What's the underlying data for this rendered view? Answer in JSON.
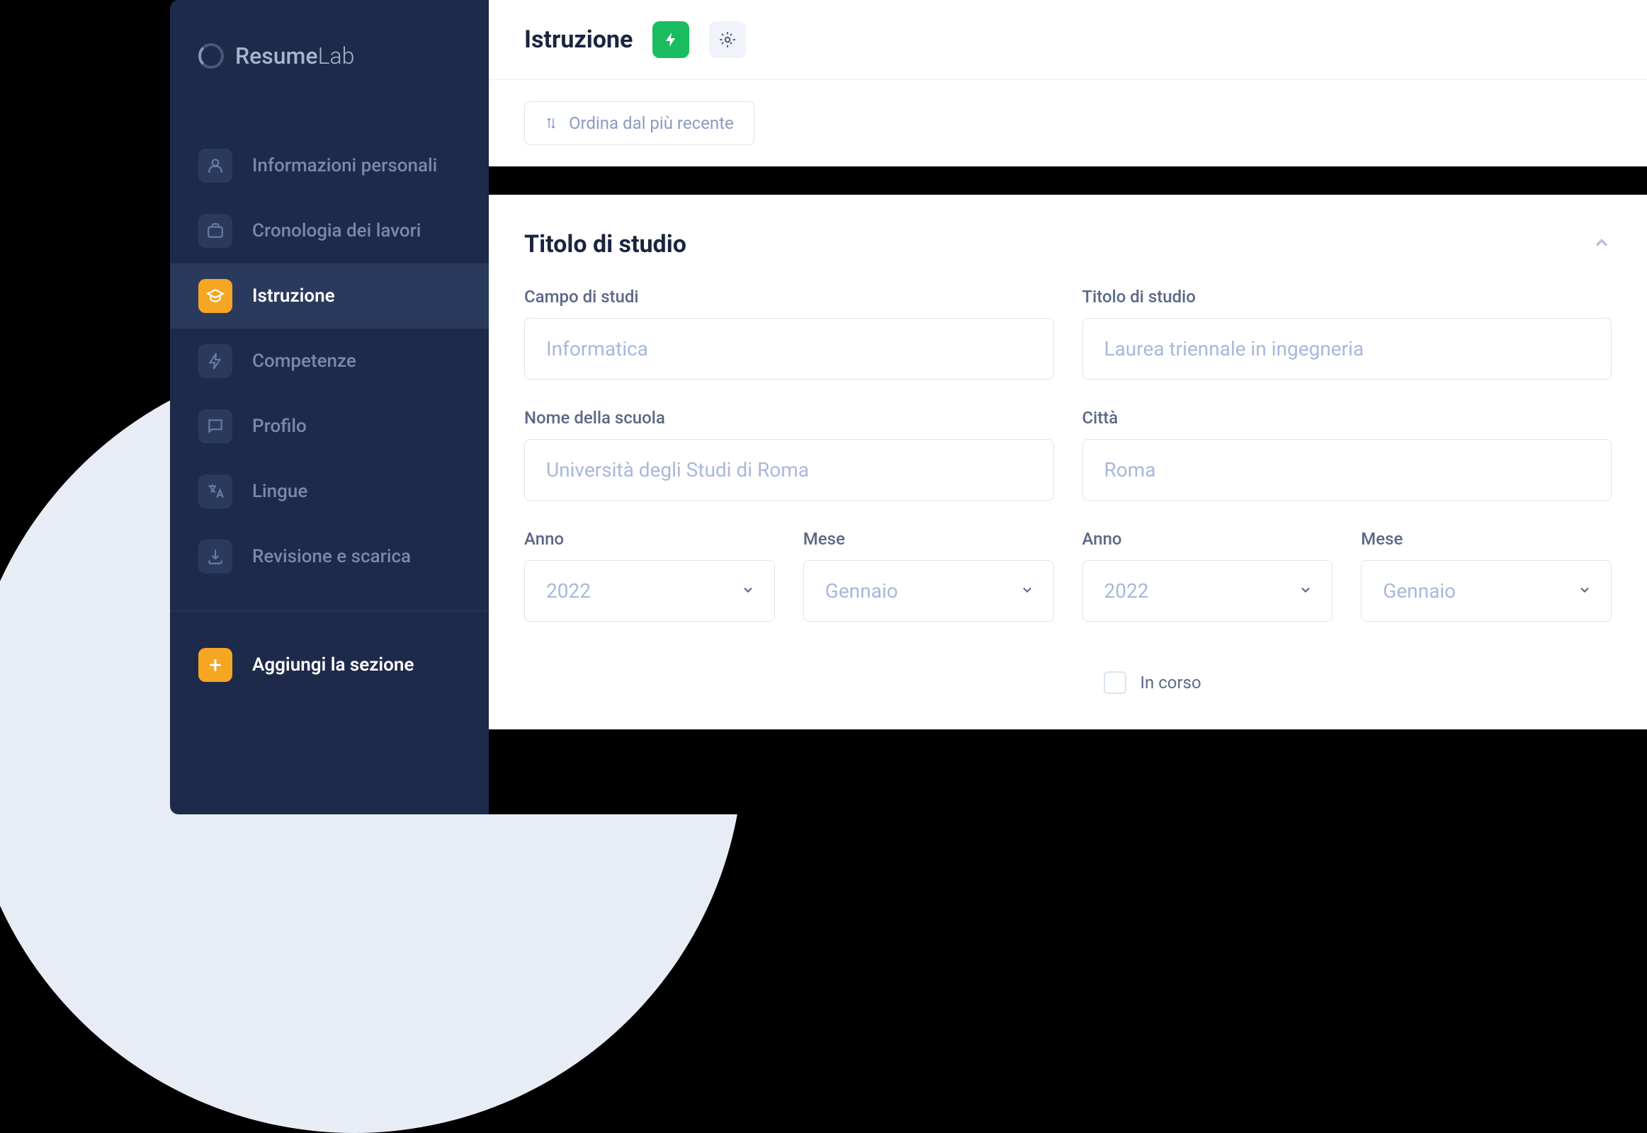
{
  "brand": {
    "name_first": "Resume",
    "name_second": "Lab"
  },
  "sidebar": {
    "items": [
      {
        "label": "Informazioni personali"
      },
      {
        "label": "Cronologia dei lavori"
      },
      {
        "label": "Istruzione"
      },
      {
        "label": "Competenze"
      },
      {
        "label": "Profilo"
      },
      {
        "label": "Lingue"
      },
      {
        "label": "Revisione e scarica"
      }
    ],
    "add_section": "Aggiungi la sezione"
  },
  "header": {
    "title": "Istruzione"
  },
  "sort": {
    "label": "Ordina dal più recente"
  },
  "card": {
    "title": "Titolo di studio",
    "fields": {
      "field_of_study": {
        "label": "Campo di studi",
        "placeholder": "Informatica"
      },
      "degree": {
        "label": "Titolo di studio",
        "placeholder": "Laurea triennale in ingegneria"
      },
      "school": {
        "label": "Nome della scuola",
        "placeholder": "Università degli Studi di Roma"
      },
      "city": {
        "label": "Città",
        "placeholder": "Roma"
      },
      "year_from": {
        "label": "Anno",
        "placeholder": "2022"
      },
      "month_from": {
        "label": "Mese",
        "placeholder": "Gennaio"
      },
      "year_to": {
        "label": "Anno",
        "placeholder": "2022"
      },
      "month_to": {
        "label": "Mese",
        "placeholder": "Gennaio"
      },
      "ongoing": {
        "label": "In corso"
      }
    }
  }
}
